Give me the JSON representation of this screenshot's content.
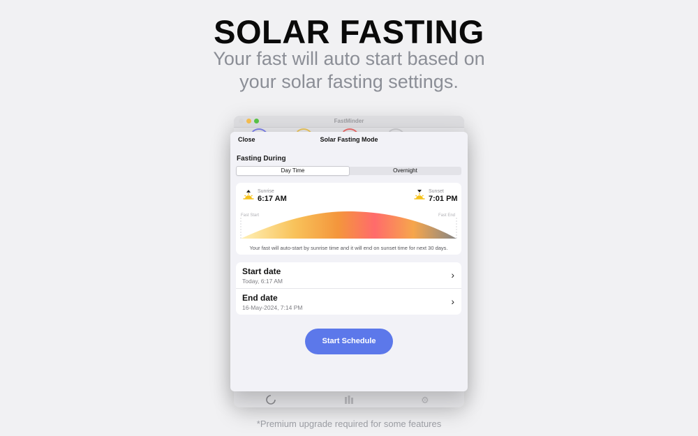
{
  "promo": {
    "headline": "SOLAR FASTING",
    "subhead_line1": "Your fast will auto start based on",
    "subhead_line2": "your solar fasting settings.",
    "footnote": "*Premium upgrade required for some features"
  },
  "window": {
    "title": "FastMinder"
  },
  "sheet": {
    "close_label": "Close",
    "title": "Solar Fasting Mode",
    "section_label": "Fasting During",
    "segments": [
      {
        "label": "Day Time",
        "selected": true
      },
      {
        "label": "Overnight",
        "selected": false
      }
    ],
    "sunrise": {
      "caption": "Sunrise",
      "time": "6:17 AM",
      "icon": "sunrise-icon"
    },
    "sunset": {
      "caption": "Sunset",
      "time": "7:01 PM",
      "icon": "sunset-icon"
    },
    "fast_start_label": "Fast Start",
    "fast_end_label": "Fast End",
    "arc_description": "Your fast will auto-start by sunrise time and it will end on sunset time for next 30 days.",
    "start_date": {
      "title": "Start date",
      "value": "Today, 6:17 AM"
    },
    "end_date": {
      "title": "End date",
      "value": "16-May-2024, 7:14 PM"
    },
    "start_button": "Start Schedule"
  },
  "colors": {
    "accent": "#5c78ea",
    "arc_gradient": [
      "#fde79c",
      "#f59d3f",
      "#ff6a6a",
      "#f5a24a",
      "#8b8b8b"
    ]
  }
}
